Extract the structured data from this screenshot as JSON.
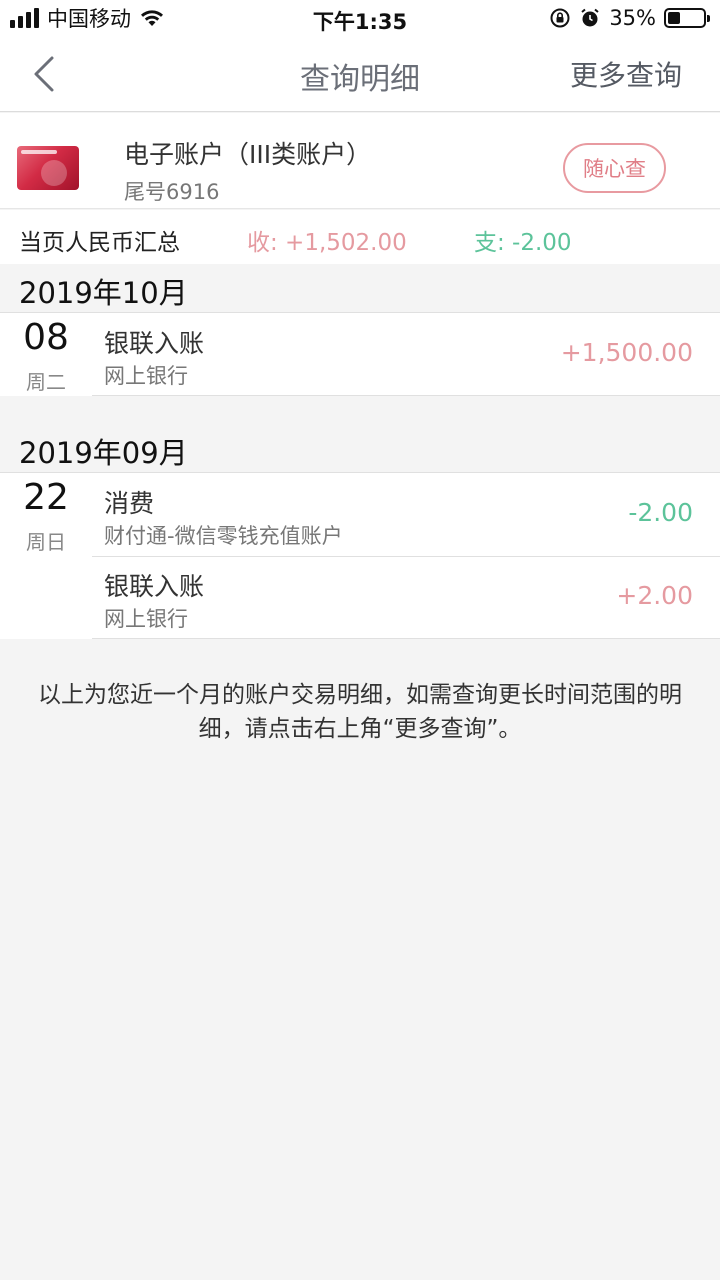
{
  "status": {
    "carrier": "中国移动",
    "time": "下午1:35",
    "battery": "35%",
    "battery_level": 0.35
  },
  "nav": {
    "title": "查询明细",
    "more": "更多查询",
    "back_icon": "chevron-left-icon"
  },
  "account": {
    "name": "电子账户（III类账户）",
    "tail": "尾号6916",
    "action": "随心查"
  },
  "summary": {
    "label": "当页人民币汇总",
    "income": "收: +1,502.00",
    "expense": "支: -2.00"
  },
  "groups": [
    {
      "month": "2019年10月",
      "days": [
        {
          "day": "08",
          "weekday": "周二",
          "txns": [
            {
              "title": "银联入账",
              "sub": "网上银行",
              "amount": "+1,500.00",
              "kind": "pos"
            }
          ]
        }
      ]
    },
    {
      "month": "2019年09月",
      "days": [
        {
          "day": "22",
          "weekday": "周日",
          "txns": [
            {
              "title": "消费",
              "sub": "财付通-微信零钱充值账户",
              "amount": "-2.00",
              "kind": "neg"
            },
            {
              "title": "银联入账",
              "sub": "网上银行",
              "amount": "+2.00",
              "kind": "pos"
            }
          ]
        }
      ]
    }
  ],
  "footnote": "以上为您近一个月的账户交易明细，如需查询更长时间范围的明细，请点击右上角“更多查询”。",
  "colors": {
    "income": "#e59aa0",
    "expense": "#5cc39a",
    "accent_button": "#e07e87"
  }
}
